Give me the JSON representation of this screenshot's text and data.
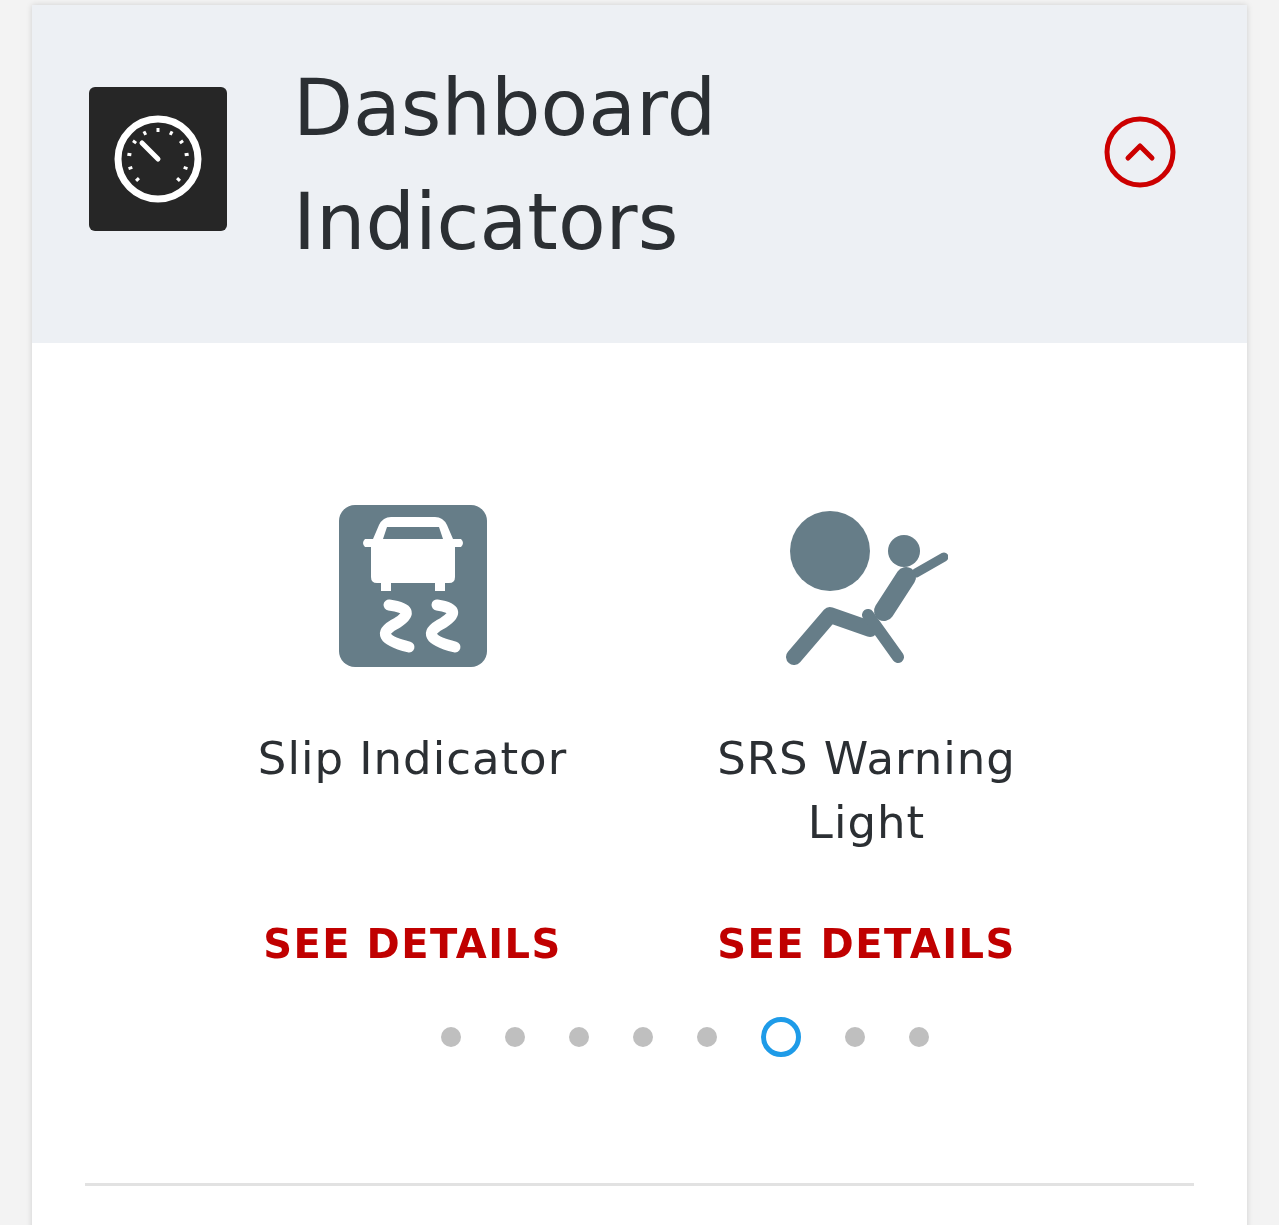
{
  "header": {
    "title": "Dashboard Indicators",
    "expanded": true
  },
  "indicators": [
    {
      "kind": "slip",
      "name": "Slip Indicator",
      "link": "SEE DETAILS"
    },
    {
      "kind": "airbag",
      "name": "SRS Warning Light",
      "link": "SEE DETAILS"
    }
  ],
  "pager": [
    {
      "selected": false
    },
    {
      "selected": false
    },
    {
      "selected": false
    },
    {
      "selected": false
    },
    {
      "selected": false
    },
    {
      "selected": true
    },
    {
      "selected": false
    },
    {
      "selected": false
    }
  ]
}
